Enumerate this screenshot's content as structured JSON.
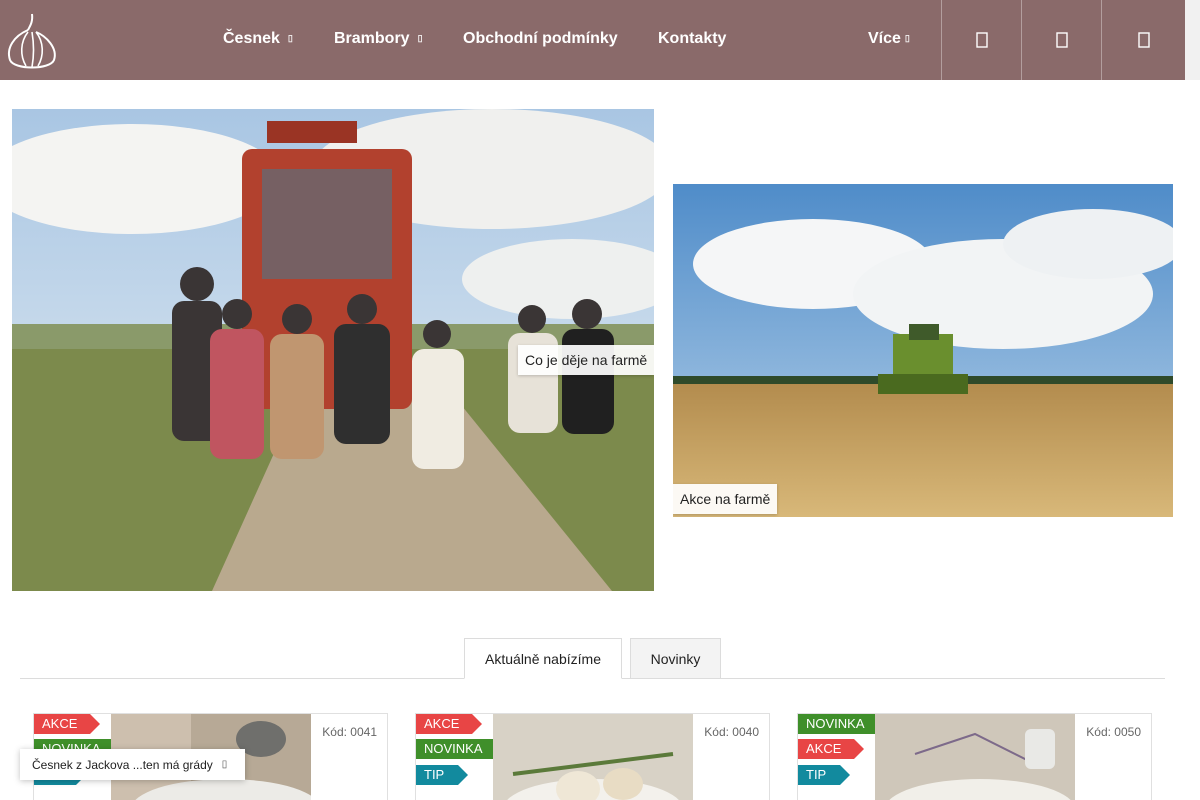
{
  "nav": {
    "items": [
      {
        "label": "Česnek",
        "caret": "▯"
      },
      {
        "label": "Brambory",
        "caret": "▯"
      },
      {
        "label": "Obchodní podmínky"
      },
      {
        "label": "Kontakty"
      },
      {
        "label": "Více",
        "caret": "▯"
      }
    ],
    "icons": [
      "search-icon",
      "user-icon",
      "cart-icon"
    ]
  },
  "banners": {
    "left_label": "Co je děje na farmě",
    "right_label": "Akce na farmě"
  },
  "tabs": [
    {
      "label": "Aktuálně nabízíme",
      "active": true
    },
    {
      "label": "Novinky",
      "active": false
    }
  ],
  "products": [
    {
      "code": "Kód: 0041",
      "flags": [
        "AKCE",
        "NOVINKA",
        "TIP"
      ]
    },
    {
      "code": "Kód: 0040",
      "flags": [
        "AKCE",
        "NOVINKA",
        "TIP"
      ]
    },
    {
      "code": "Kód: 0050",
      "flags": [
        "NOVINKA",
        "AKCE",
        "TIP"
      ]
    }
  ],
  "toast": {
    "text": "Česnek z Jackova ...ten má grády",
    "close": "▯"
  },
  "colors": {
    "header": "#8a6a6a",
    "akce": "#e84545",
    "novinka": "#3f8f2a",
    "tip": "#128a9e"
  }
}
